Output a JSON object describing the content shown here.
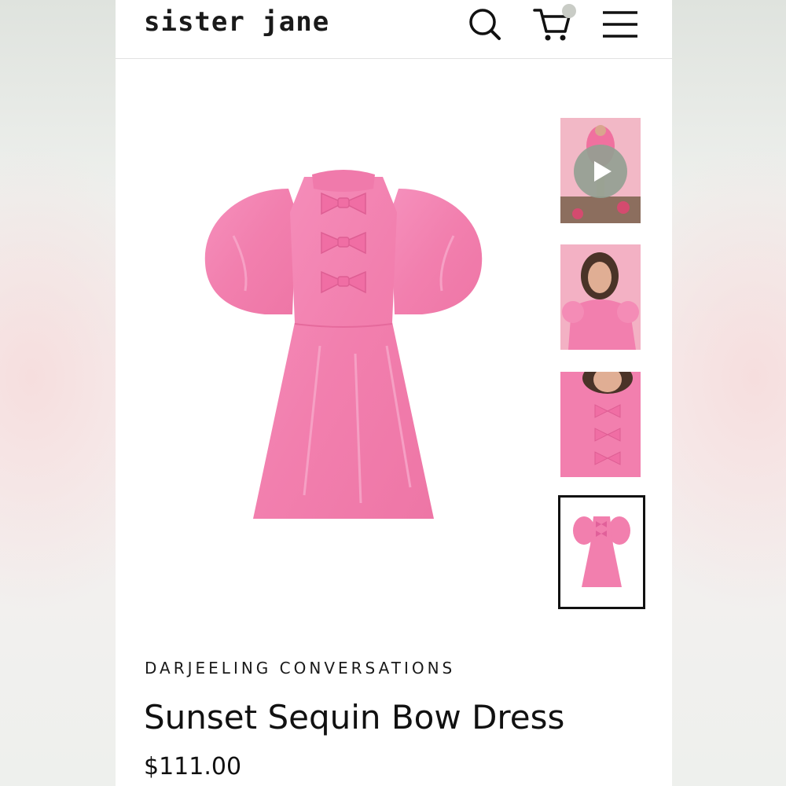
{
  "header": {
    "logo": "sister jane",
    "icons": [
      "search-icon",
      "cart-icon",
      "menu-icon"
    ]
  },
  "gallery": {
    "thumbnails": [
      {
        "kind": "video",
        "icon": "play-icon"
      },
      {
        "kind": "image"
      },
      {
        "kind": "image"
      },
      {
        "kind": "image",
        "selected": true
      }
    ]
  },
  "product": {
    "brand": "DARJEELING CONVERSATIONS",
    "title": "Sunset Sequin Bow Dress",
    "price": "$111.00"
  },
  "colors": {
    "dress_pink": "#f27fae",
    "accent_dark": "#111111",
    "cart_badge": "#c9ccc6"
  }
}
